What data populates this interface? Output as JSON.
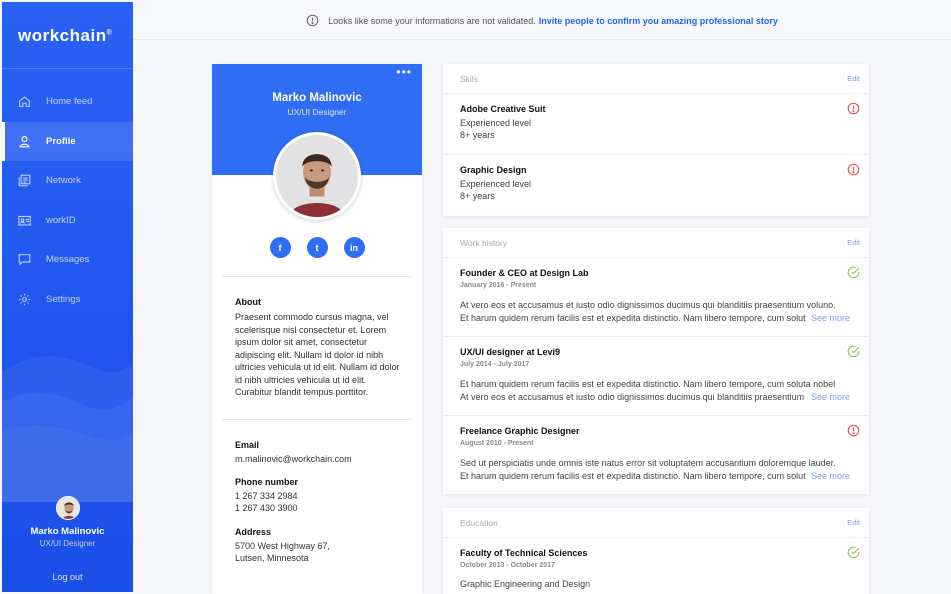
{
  "sidebar": {
    "logo": "workchain",
    "nav": [
      {
        "label": "Home feed",
        "icon": "home-icon"
      },
      {
        "label": "Profile",
        "icon": "user-icon",
        "active": true
      },
      {
        "label": "Network",
        "icon": "network-icon"
      },
      {
        "label": "workID",
        "icon": "id-card-icon"
      },
      {
        "label": "Messages",
        "icon": "chat-icon"
      },
      {
        "label": "Settings",
        "icon": "gear-icon"
      }
    ],
    "user_name": "Marko Malinovic",
    "user_role": "UX/UI Designer",
    "logout_label": "Log out"
  },
  "notice": {
    "text": "Looks like some your informations are not validated.",
    "link": "Invite people to confirm you amazing professional story"
  },
  "profile": {
    "name": "Marko Malinovic",
    "role": "UX/UI Designer",
    "socials": [
      "f",
      "t",
      "in"
    ],
    "about_label": "About",
    "about_text": "Praesent commodo cursus magna, vel scelerisque nisl consectetur et. Lorem ipsum dolor sit amet, consectetur adipiscing elit. Nullam id dolor id nibh ultricies vehicula ut id elit. Nullam id dolor id nibh ultricies vehicula ut id elit. Curabitur blandit tempus porttitor.",
    "email_label": "Email",
    "email": "m.malinovic@workchain.com",
    "phone_label": "Phone number",
    "phone1": "1 267 334 2984",
    "phone2": "1 267 430 3900",
    "address_label": "Address",
    "address1": "5700 West Highway 67,",
    "address2": "Lutsen, Minnesota"
  },
  "skills": {
    "title": "Skils",
    "edit": "Edit",
    "items": [
      {
        "title": "Adobe Creative Suit",
        "level": "Experienced level",
        "years": "8+ years",
        "status": "warning"
      },
      {
        "title": "Graphic Design",
        "level": "Experienced level",
        "years": "8+ years",
        "status": "warning"
      }
    ]
  },
  "work": {
    "title": "Work history",
    "edit": "Edit",
    "see_more": "See more",
    "items": [
      {
        "title": "Founder & CEO at Design Lab",
        "date": "January 2016 - Present",
        "line1": "At vero eos et accusamus et iusto odio dignissimos ducimus qui blanditiis  praesentium voluno.",
        "line2": "Et harum quidem rerum facilis est et expedita distinctio. Nam libero tempore, cum soluta nobel",
        "status": "verified"
      },
      {
        "title": "UX/UI designer at Levi9",
        "date": "July 2014 - July 2017",
        "line1": "Et harum quidem rerum facilis est et expedita distinctio. Nam libero tempore, cum soluta nobel",
        "line2": "At vero eos et accusamus et iusto odio dignissimos ducimus qui blanditiis  praesentium voluno.",
        "status": "verified"
      },
      {
        "title": "Freelance Graphic Designer",
        "date": "August 2010 - Present",
        "line1": "Sed ut perspiciatis unde omnis iste natus error sit voluptatem accusantium doloremque lauder.",
        "line2": "Et harum quidem rerum facilis est et expedita distinctio. Nam libero tempore, cum soluta nobel",
        "status": "warning"
      }
    ]
  },
  "education": {
    "title": "Education",
    "edit": "Edit",
    "items": [
      {
        "title": "Faculty of Technical Sciences",
        "date": "October 2013 - October 2017",
        "line": "Graphic Engineering and Design",
        "status": "verified"
      }
    ]
  },
  "colors": {
    "primary": "#2f6df5",
    "warning": "#e5484d",
    "verified": "#8bc34a",
    "link": "#2563eb"
  }
}
